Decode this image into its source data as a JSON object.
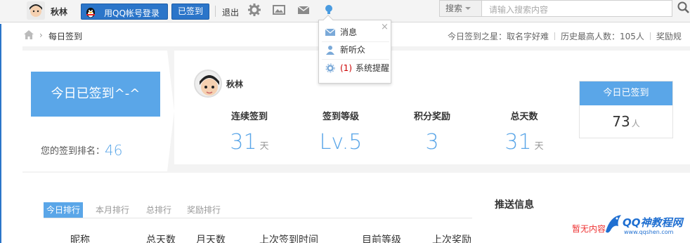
{
  "topbar": {
    "username": "秋林",
    "qq_login_label": "用QQ帐号登录",
    "signed_label": "已签到",
    "logout_label": "退出",
    "search_select": "搜索",
    "search_placeholder": "请输入搜索内容"
  },
  "breadcrumb": {
    "current": "每日签到",
    "arrow": "›"
  },
  "stats_line": {
    "star": "今日签到之星：取名字好难",
    "record": "历史最高人数：105人",
    "reward": "奖励规"
  },
  "sign_card": {
    "button_label": "今日已签到^-^",
    "rank_label": "您的签到排名：",
    "rank_value": "46"
  },
  "profile": {
    "name": "秋林"
  },
  "stats": [
    {
      "label": "连续签到",
      "value": "31",
      "unit": "天"
    },
    {
      "label": "签到等级",
      "value": "Lv.5",
      "unit": ""
    },
    {
      "label": "积分奖励",
      "value": "3",
      "unit": ""
    },
    {
      "label": "总天数",
      "value": "31",
      "unit": "天"
    }
  ],
  "today_card": {
    "title": "今日已签到",
    "count": "73",
    "unit": "人"
  },
  "tabs": [
    "今日排行",
    "本月排行",
    "总排行",
    "奖励排行"
  ],
  "push_title": "推送信息",
  "table_headers": [
    "昵称",
    "总天数",
    "月天数",
    "上次签到时间",
    "目前等级",
    "上次奖励"
  ],
  "no_content": "暂无内容",
  "watermark": {
    "title": "QQ神教程网",
    "url": "www.qqshen.com"
  },
  "dropdown": {
    "close": "×",
    "items": [
      {
        "label": "消息",
        "icon": "mail-icon"
      },
      {
        "label": "新听众",
        "icon": "person-icon"
      },
      {
        "label": "系统提醒",
        "count": "(1)",
        "icon": "gear-icon"
      }
    ]
  },
  "colors": {
    "primary": "#5aa6e8",
    "qq_blue": "#2b75c9",
    "alert": "#e33"
  }
}
